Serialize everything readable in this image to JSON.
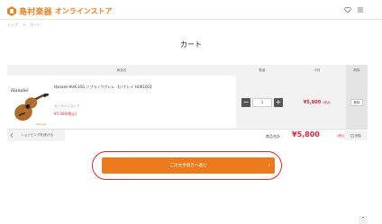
{
  "header": {
    "logo_text": "島村楽器",
    "logo_sub": "オンラインストア",
    "brand_color": "#e8822a"
  },
  "breadcrumb": {
    "home": "トップ",
    "sep": ">",
    "current": "カート"
  },
  "page_title": "カート",
  "table": {
    "col_item": "商品名",
    "col_qty": "数量",
    "col_subtotal": "小計",
    "col_delete": "削除"
  },
  "item": {
    "brand_script": "Hanalei",
    "brand_tag": "Hanalei",
    "name": "Hanalei HUK-10G ソプラノウクレレ 【ハナレイ HUK10G】",
    "store": "オンラインストア",
    "unit_price": "¥5,000(税込)",
    "quantity": "1",
    "minus": "−",
    "plus": "+",
    "subtotal": "¥5,800",
    "subtotal_tax": "(税込)",
    "delete_label": "削除"
  },
  "actions": {
    "continue_label": "ショッピングを続ける",
    "total_label": "商品合計 :",
    "total_value": "¥5,800",
    "total_tax": "(税込)",
    "clear_label": "削除"
  },
  "checkout": {
    "label": "ご注文手続きへ進む",
    "color": "#ec7a1c",
    "highlight_color": "#e02b2b"
  },
  "scroll_top_label": "^"
}
